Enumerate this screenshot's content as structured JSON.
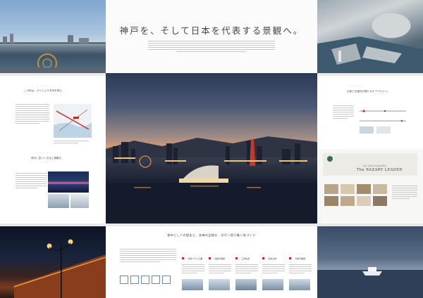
{
  "spread": {
    "headline": "神戸を、そして日本を代表する景観へ。",
    "panel_left_mid_heading": "この街は、かつてより未来を育む。",
    "panel_left_lower_heading": "神戸に息づく文化と景観を。",
    "panel_right_mid_heading": "伝統と先進性が織りなすアクセスへ。",
    "concierge_brand": "The RAZARY LEADER",
    "concierge_sub": "Life with hospitality",
    "bottom_heading": "都市としての歴史と、洗練の品格を、次代へ受け継ぐ街づくり",
    "companies": [
      "大和ハウス工業",
      "近鉄不動産",
      "三井住友",
      "日本土地",
      "大和不動産"
    ],
    "colors": {
      "page_bg": "#ffffff",
      "gutter": "#e9e9e9",
      "text": "#333333",
      "accent_red": "#b8321d"
    }
  }
}
